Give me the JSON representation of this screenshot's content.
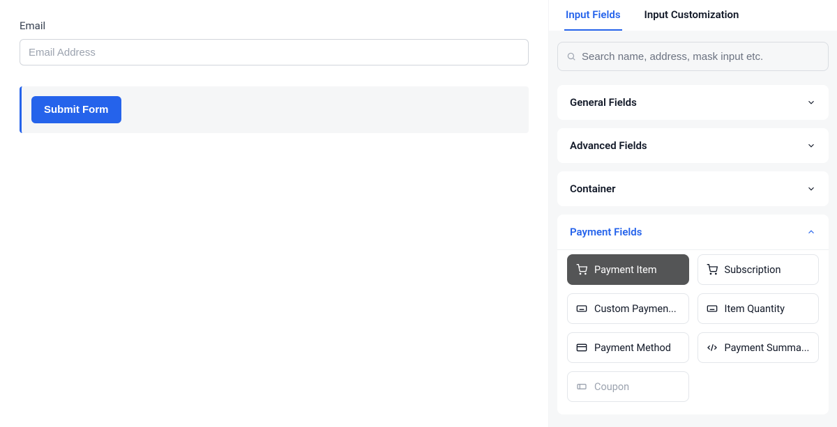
{
  "form": {
    "email_label": "Email",
    "email_placeholder": "Email Address",
    "submit_label": "Submit Form"
  },
  "sidebar": {
    "tabs": {
      "input_fields": "Input Fields",
      "input_customization": "Input Customization"
    },
    "search_placeholder": "Search name, address, mask input etc.",
    "sections": {
      "general": "General Fields",
      "advanced": "Advanced Fields",
      "container": "Container",
      "payment": "Payment Fields"
    },
    "payment_items": {
      "payment_item": "Payment Item",
      "subscription": "Subscription",
      "custom_payment": "Custom Paymen...",
      "item_quantity": "Item Quantity",
      "payment_method": "Payment Method",
      "payment_summary": "Payment Summa...",
      "coupon": "Coupon"
    }
  },
  "colors": {
    "accent": "#2563eb",
    "card_dark": "#545556",
    "border": "#e3e6ea",
    "bg_panel": "#f6f7f8"
  }
}
